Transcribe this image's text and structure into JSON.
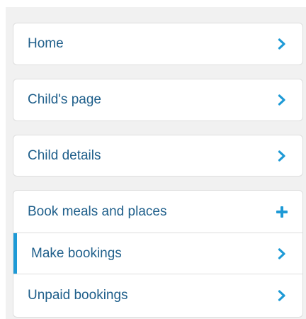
{
  "nav": {
    "items": [
      {
        "label": "Home",
        "icon": "chevron-right-icon"
      },
      {
        "label": "Child's page",
        "icon": "chevron-right-icon"
      },
      {
        "label": "Child details",
        "icon": "chevron-right-icon"
      }
    ],
    "group": {
      "label": "Book meals and places",
      "icon": "plus-icon",
      "children": [
        {
          "label": "Make bookings",
          "icon": "chevron-right-icon",
          "active": true
        },
        {
          "label": "Unpaid bookings",
          "icon": "chevron-right-icon",
          "active": false
        }
      ]
    }
  },
  "colors": {
    "text": "#1f5f8b",
    "icon": "#1e9ad6",
    "active_indicator": "#1e9ad6",
    "panel_background": "#f1f1f1",
    "border": "#dedede"
  }
}
